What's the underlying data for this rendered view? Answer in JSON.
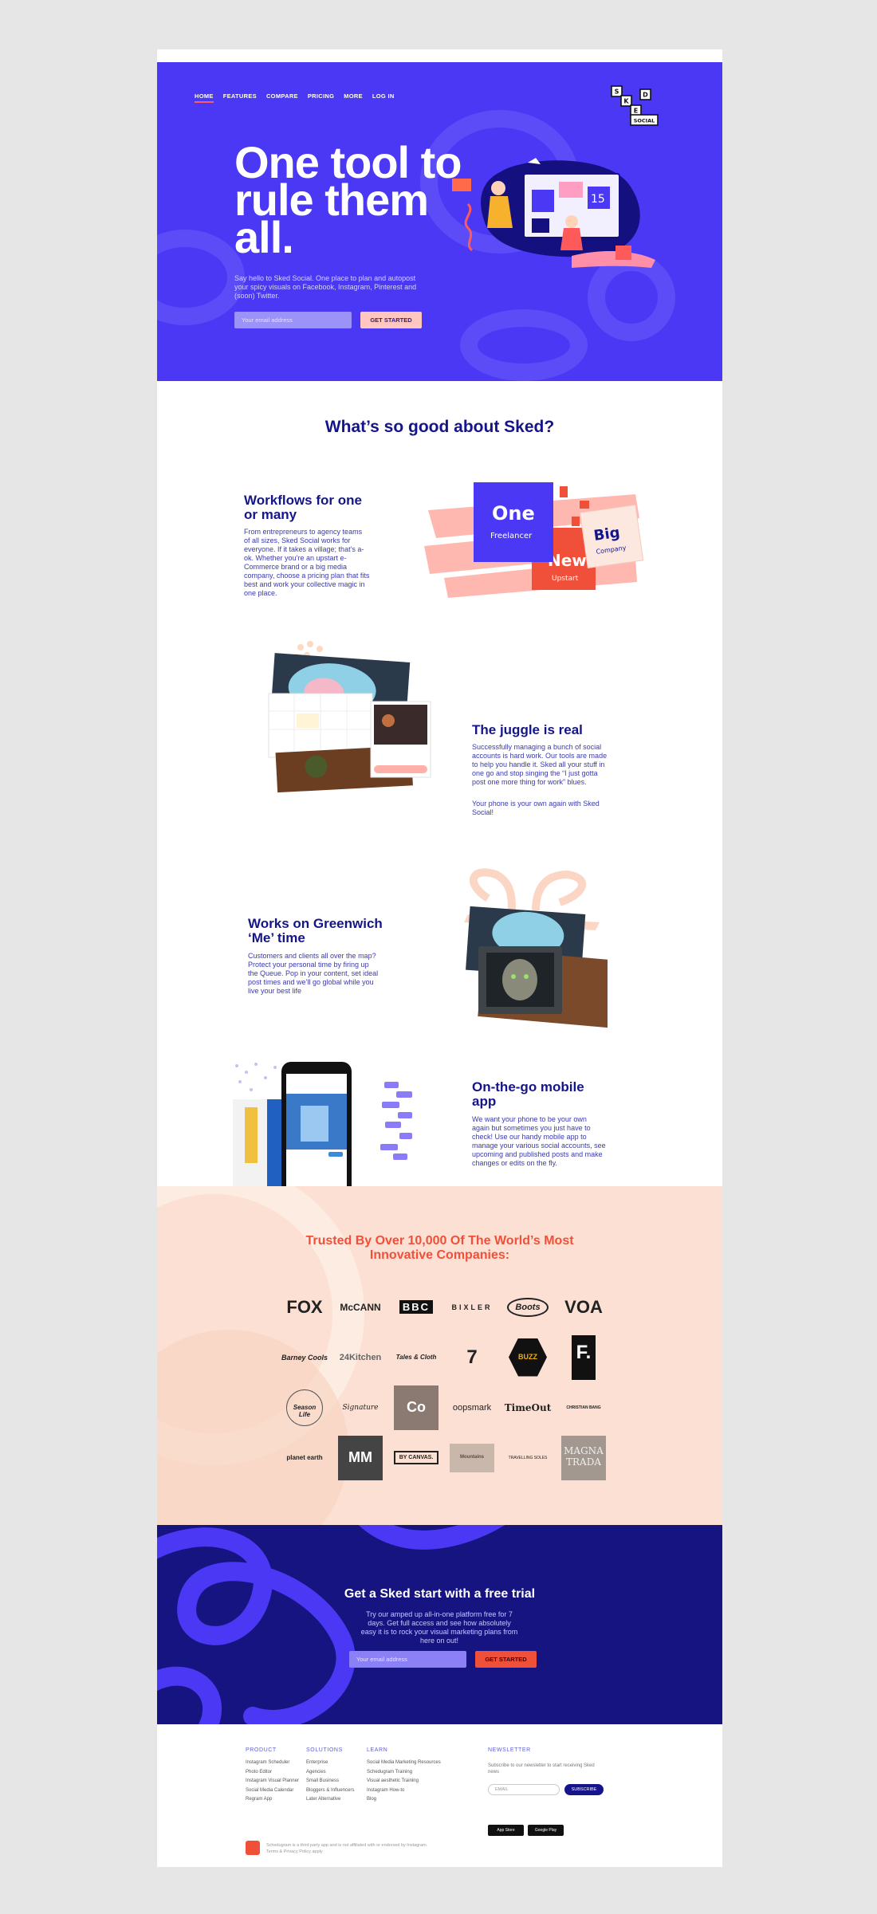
{
  "nav": {
    "items": [
      "HOME",
      "FEATURES",
      "COMPARE",
      "PRICING",
      "MORE",
      "LOG IN"
    ]
  },
  "logo": {
    "letters": [
      "S",
      "K",
      "E",
      "D"
    ],
    "word": "SOCIAL"
  },
  "hero": {
    "title": "One tool to rule them all.",
    "subtitle": "Say hello to Sked Social. One place to plan and autopost your spicy visuals on Facebook, Instagram, Pinterest and (soon) Twitter.",
    "email_placeholder": "Your email address",
    "cta_label": "GET STARTED",
    "illustration_badge": "15"
  },
  "features": {
    "heading": "What’s so good about Sked?",
    "items": [
      {
        "title": "Workflows for one or many",
        "body": "From entrepreneurs to agency teams of all sizes, Sked Social works for everyone. If it takes a village; that’s a-ok. Whether you’re an upstart e-Commerce brand or a big media company, choose a pricing plan that fits best and work your collective magic in one place."
      },
      {
        "title": "The juggle is real",
        "body": "Successfully managing a bunch of social accounts is hard work. Our tools are made to help you handle it. Sked all your stuff in one go and stop singing the “I just gotta post one more thing for work” blues.",
        "body2": "Your phone is your own again with Sked Social!"
      },
      {
        "title": "Works on Greenwich ‘Me’ time",
        "body": "Customers and clients all over the map? Protect your personal time by firing up the Queue. Pop in your content, set ideal post times and we’ll go global while you live your best life"
      },
      {
        "title": "On-the-go mobile app",
        "body": "We want your phone to be your own again but sometimes you just have to check! Use our handy mobile app to manage your various social accounts, see upcoming and published posts and make changes or edits on the fly."
      }
    ],
    "plans": {
      "one": "One",
      "one_sub": "Freelancer",
      "new": "New",
      "new_sub": "Upstart",
      "big": "Big",
      "big_sub": "Company"
    }
  },
  "trusted": {
    "heading": "Trusted By Over 10,000 Of The World’s Most Innovative Companies:",
    "logos": [
      "FOX",
      "McCANN",
      "BBC",
      "BIXLER",
      "Boots",
      "VOA",
      "Barney Cools",
      "24Kitchen",
      "Tales & Cloth",
      "7",
      "BUZZ",
      "F.",
      "Season Life",
      "Signature",
      "Co",
      "oopsmark",
      "TimeOut",
      "CHRISTIAN BANG",
      "planet earth",
      "MM",
      "BY CANVAS.",
      "Mountains",
      "TRAVELLING SOLES",
      "MAGNA TRADA"
    ]
  },
  "cta": {
    "heading": "Get a Sked start with a free trial",
    "body": "Try our amped up all-in-one platform free for 7 days. Get full access and see how absolutely easy it is to rock your visual marketing plans from here on out!",
    "email_placeholder": "Your email address",
    "button": "GET STARTED"
  },
  "footer": {
    "columns": [
      {
        "heading": "PRODUCT",
        "items": [
          "Instagram Scheduler",
          "Photo Editor",
          "Instagram Visual Planner",
          "Social Media Calendar",
          "Regram App"
        ]
      },
      {
        "heading": "SOLUTIONS",
        "items": [
          "Enterprise",
          "Agencies",
          "Small Business",
          "Bloggers & Influencers",
          "Later Alternative"
        ]
      },
      {
        "heading": "LEARN",
        "items": [
          "Social Media Marketing Resources",
          "Schedugram Training",
          "Visual aesthetic Training",
          "Instagram How-to",
          "Blog"
        ]
      }
    ],
    "newsletter": {
      "heading": "NEWSLETTER",
      "text": "Subscribe to our newsletter to start receiving Sked news",
      "email_placeholder": "EMAIL",
      "button": "SUBSCRIBE"
    },
    "app_store": "App Store",
    "google_play": "Google Play",
    "note": "Schedugram is a third party app and is not affiliated with or endorsed by Instagram.",
    "links": "Terms & Privacy Policy apply"
  }
}
